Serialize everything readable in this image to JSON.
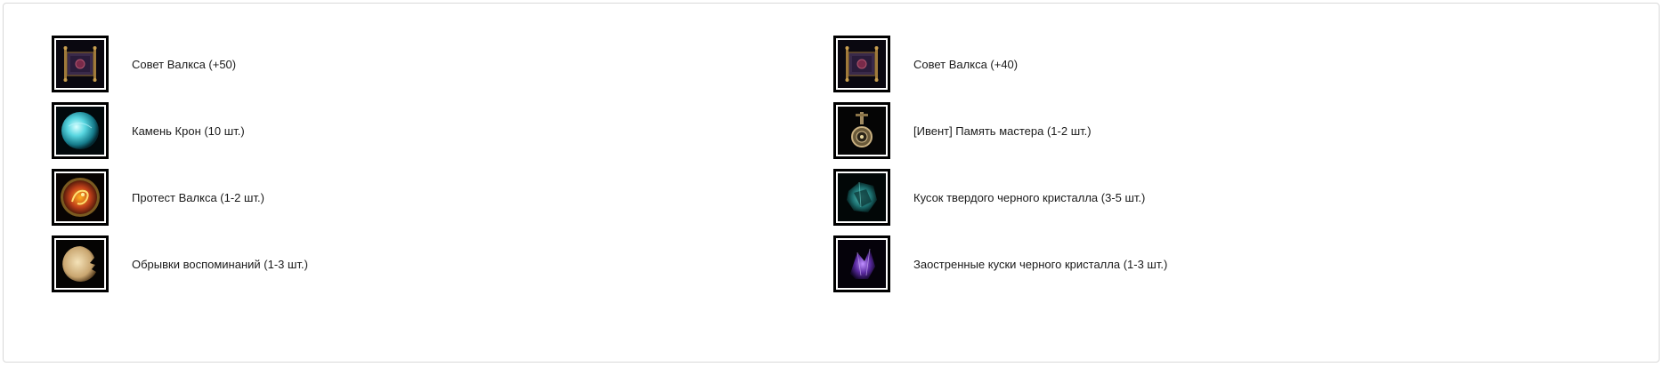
{
  "items": [
    {
      "label": "Совет Валкса (+50)",
      "icon": "scroll-icon"
    },
    {
      "label": "Камень Крон (10 шт.)",
      "icon": "cyan-orb-icon"
    },
    {
      "label": "Протест Валкса (1-2 шт.)",
      "icon": "dragon-coin-icon"
    },
    {
      "label": "Обрывки воспоминаний (1-3 шт.)",
      "icon": "torn-paper-icon"
    },
    {
      "label": "Совет Валкса (+40)",
      "icon": "scroll-icon"
    },
    {
      "label": "[Ивент] Память мастера (1-2 шт.)",
      "icon": "pendant-icon"
    },
    {
      "label": "Кусок твердого черного кристалла (3-5 шт.)",
      "icon": "teal-crystal-icon"
    },
    {
      "label": "Заостренные куски черного кристалла (1-3 шт.)",
      "icon": "purple-crystal-icon"
    }
  ]
}
